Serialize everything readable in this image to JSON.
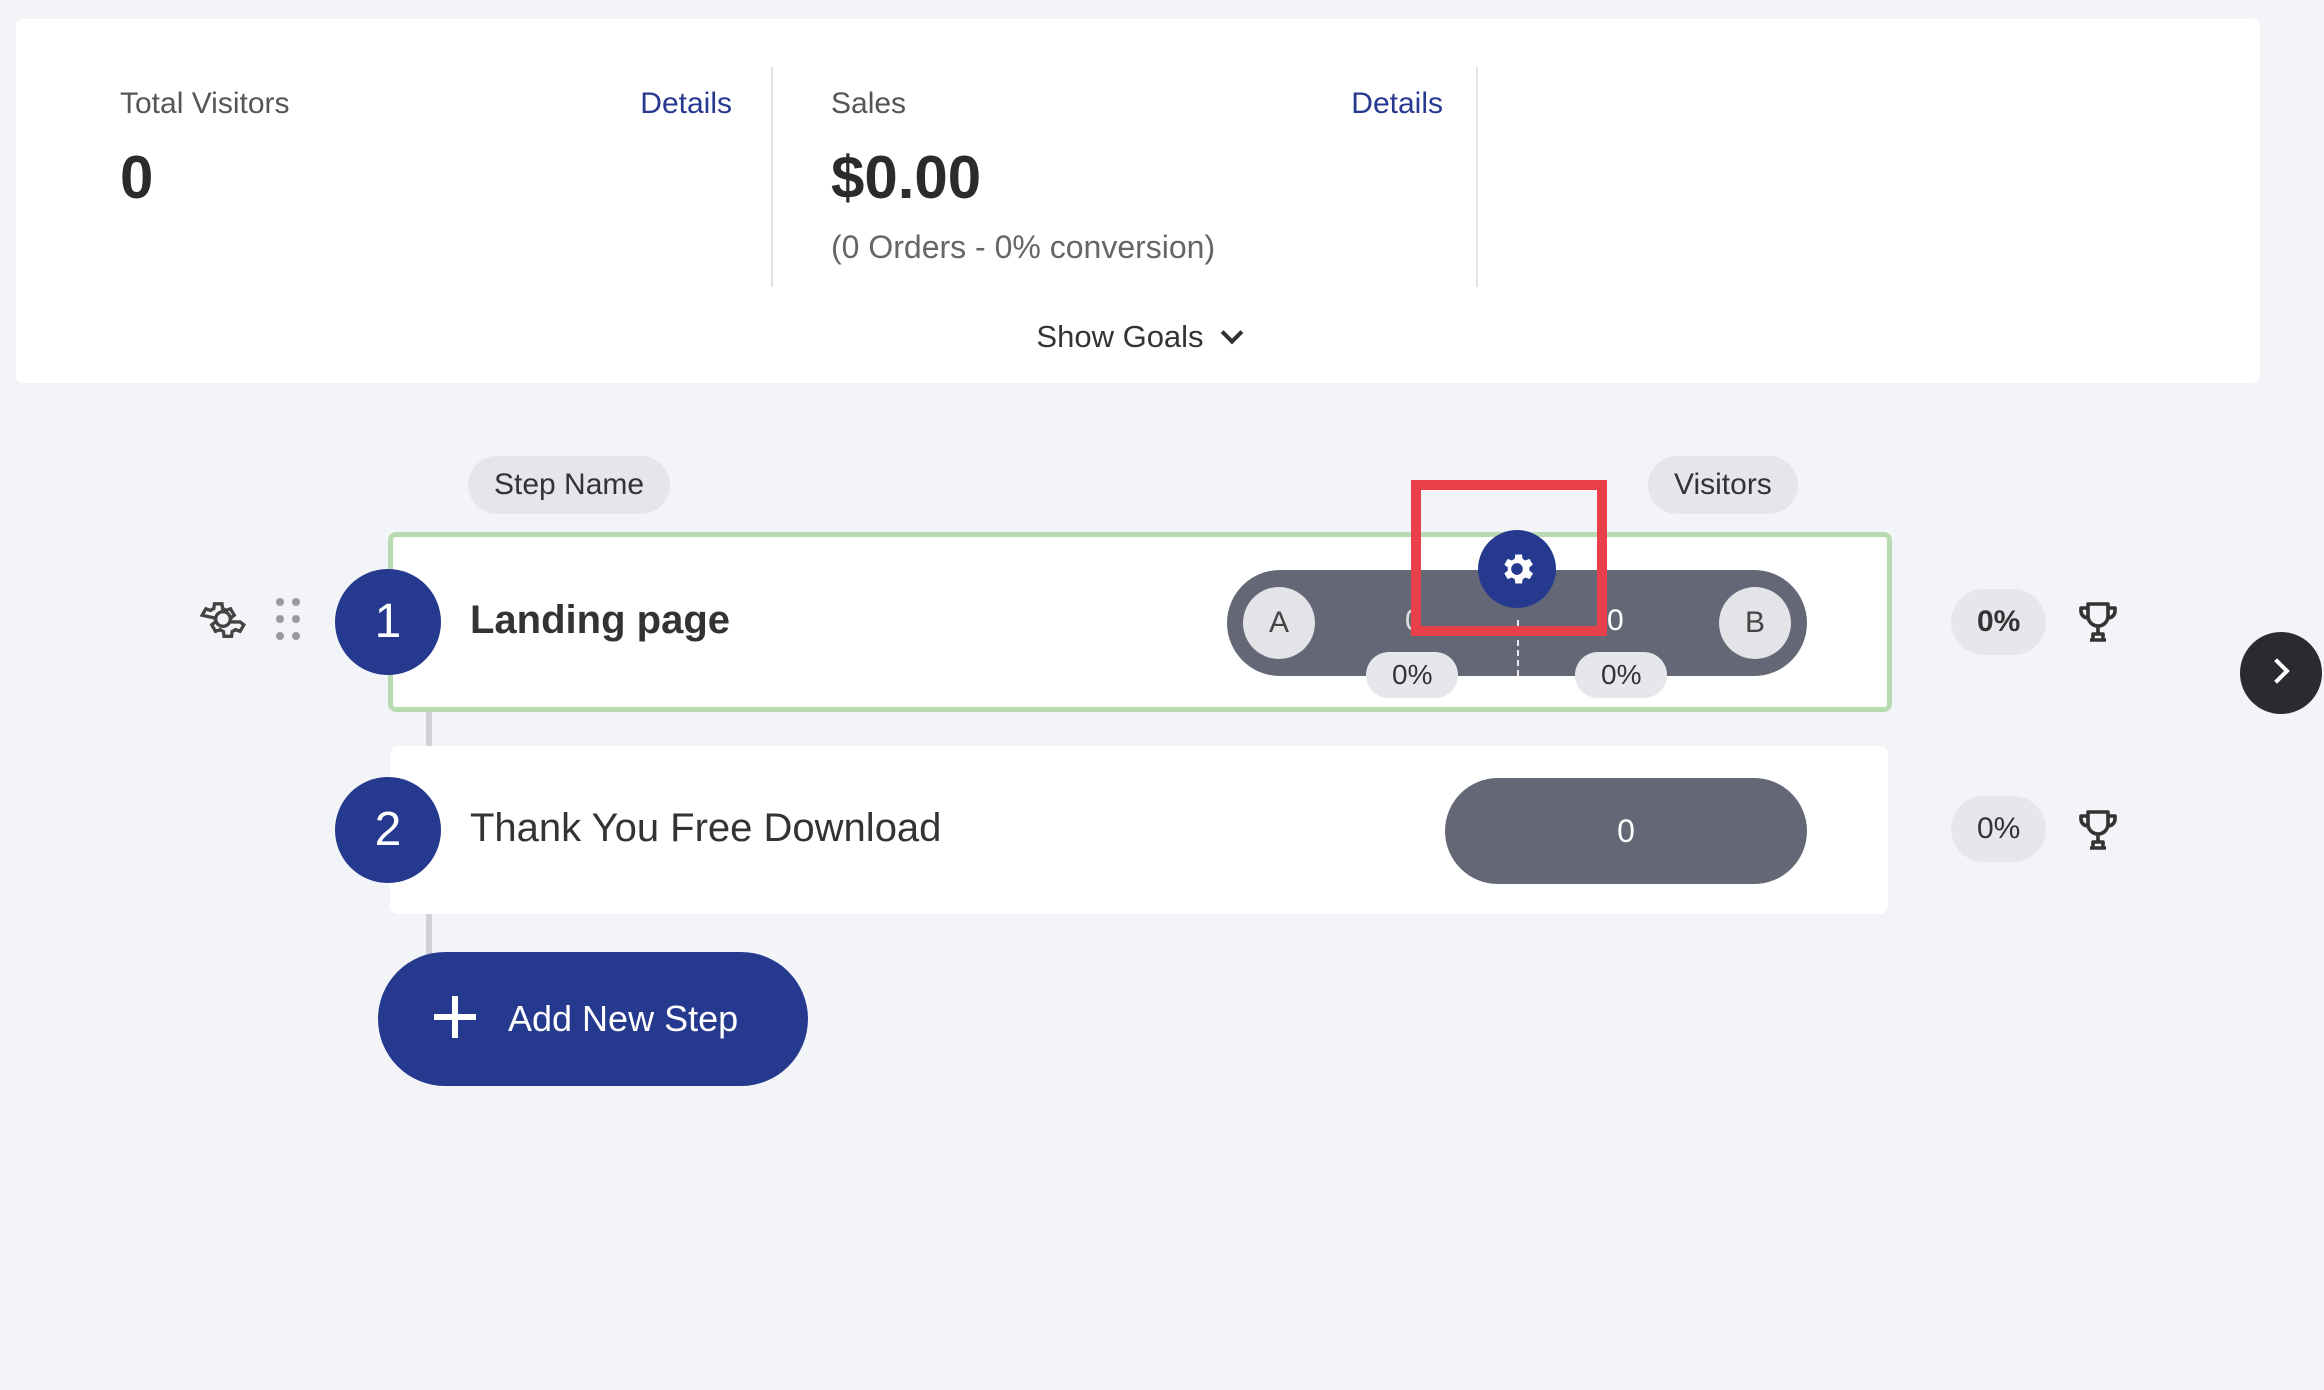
{
  "stats": {
    "total_visitors": {
      "label": "Total Visitors",
      "details": "Details",
      "value": "0"
    },
    "sales": {
      "label": "Sales",
      "details": "Details",
      "value": "$0.00",
      "sub": "(0 Orders - 0% conversion)"
    },
    "show_goals": "Show Goals"
  },
  "columns": {
    "step_name": "Step Name",
    "visitors": "Visitors"
  },
  "steps": [
    {
      "number": "1",
      "name": "Landing page",
      "variant_a": {
        "label": "A",
        "visitors": "0",
        "pct": "0%"
      },
      "variant_b": {
        "label": "B",
        "visitors": "0",
        "pct": "0%"
      },
      "conversion": "0%"
    },
    {
      "number": "2",
      "name": "Thank You Free Download",
      "visitors": "0",
      "conversion": "0%"
    }
  ],
  "add_step": "Add New Step",
  "colors": {
    "primary": "#253a8f",
    "highlight": "#e8404a",
    "active_border": "#b8dab0",
    "pill": "#646776"
  },
  "icons": [
    "gear-icon",
    "drag-handle-icon",
    "trophy-icon",
    "plus-icon",
    "chevron-down-icon",
    "chevron-right-icon"
  ]
}
